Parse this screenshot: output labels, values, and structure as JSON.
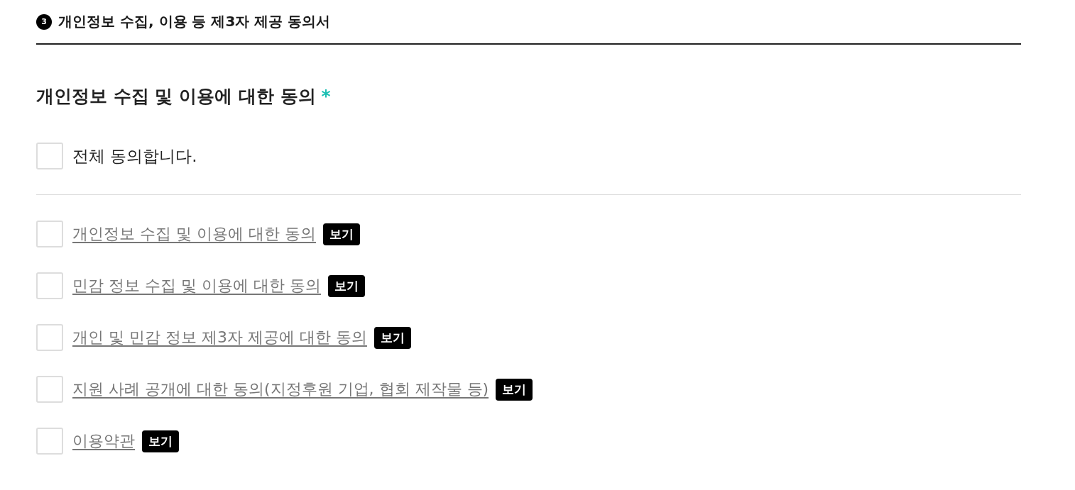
{
  "section": {
    "number": "3",
    "title": "개인정보 수집, 이용 등 제3자 제공 동의서"
  },
  "consent": {
    "heading": "개인정보 수집 및 이용에 대한 동의",
    "required_mark": "*",
    "select_all": {
      "label": "전체 동의합니다.",
      "checked": false
    },
    "items": [
      {
        "label": "개인정보 수집 및 이용에 대한 동의",
        "checked": false,
        "view_button": "보기"
      },
      {
        "label": "민감 정보 수집 및 이용에 대한 동의",
        "checked": false,
        "view_button": "보기"
      },
      {
        "label": "개인 및 민감 정보 제3자 제공에 대한 동의",
        "checked": false,
        "view_button": "보기"
      },
      {
        "label": "지원 사례 공개에 대한 동의(지정후원 기업, 협회 제작물 등)",
        "checked": false,
        "view_button": "보기"
      },
      {
        "label": "이용약관",
        "checked": false,
        "view_button": "보기"
      }
    ]
  }
}
